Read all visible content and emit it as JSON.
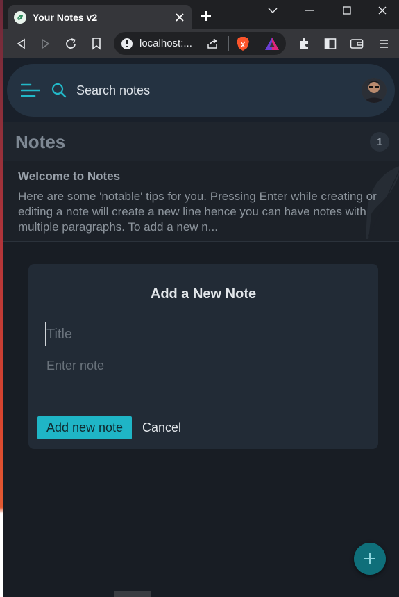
{
  "browser": {
    "tab_title": "Your Notes v2",
    "url": "localhost:..."
  },
  "app": {
    "search_placeholder": "Search notes",
    "notes_heading": "Notes",
    "notes_count": "1",
    "notes": [
      {
        "title": "Welcome to Notes",
        "body": "Here are some 'notable' tips for you. Pressing Enter while creating or editing a note will create a new line hence you can have notes with multiple paragraphs. To add a new n..."
      }
    ]
  },
  "modal": {
    "heading": "Add a New Note",
    "title_placeholder": "Title",
    "title_value": "",
    "note_placeholder": "Enter note",
    "note_value": "",
    "submit_label": "Add new note",
    "cancel_label": "Cancel"
  },
  "colors": {
    "accent": "#1fb5c6",
    "fab": "#0f6f7a"
  },
  "icons": [
    "leaf-icon",
    "close-icon",
    "plus-icon",
    "back-icon",
    "forward-icon",
    "reload-icon",
    "bookmark-icon",
    "info-icon",
    "share-icon",
    "brave-lion-icon",
    "brave-rewards-icon",
    "extensions-icon",
    "sidebar-icon",
    "wallet-icon",
    "menu-icon",
    "hamburger-icon",
    "search-icon",
    "feather-icon"
  ]
}
